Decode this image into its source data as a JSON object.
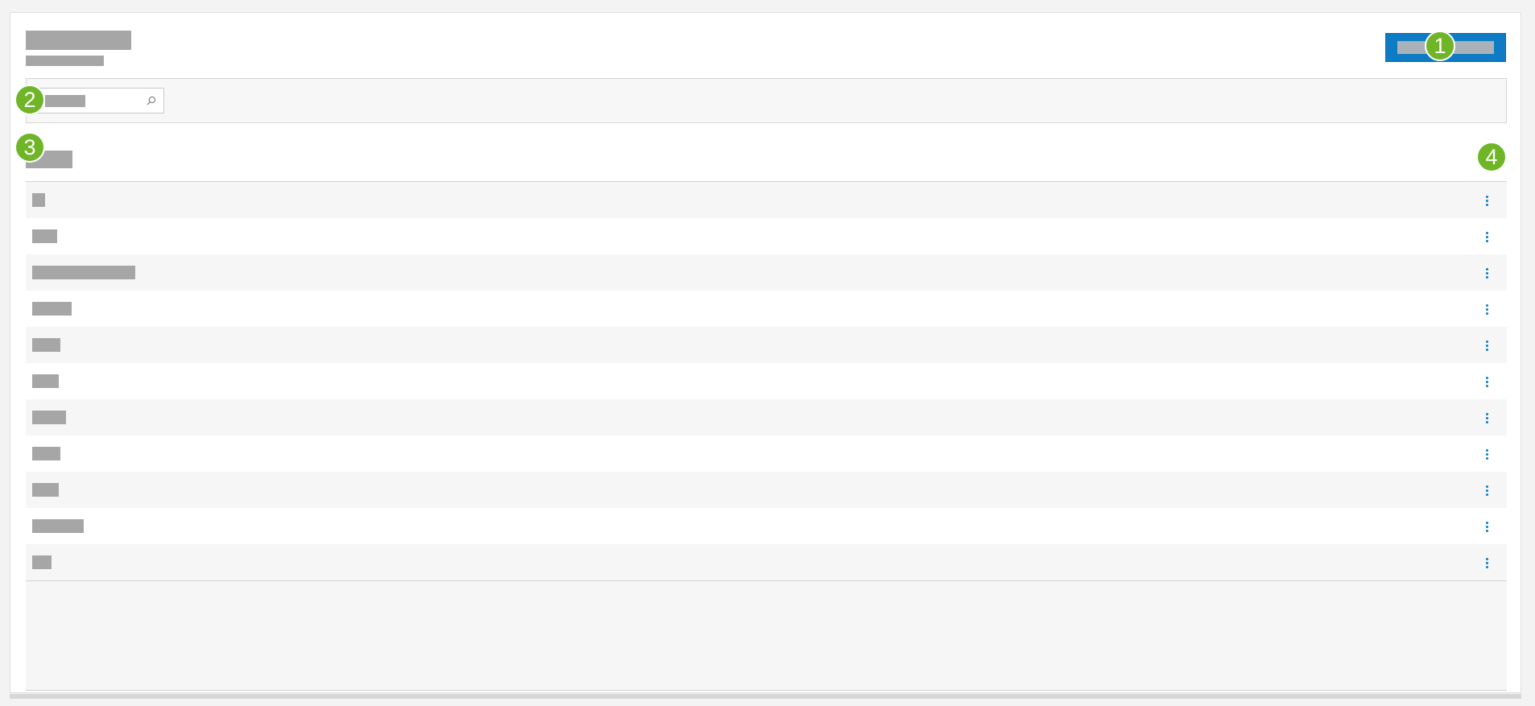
{
  "colors": {
    "accent": "#0e7cc4",
    "callout": "#6fb527",
    "placeholder": "#a6a6a6"
  },
  "header": {
    "title": "",
    "subtitle": "",
    "primary_button_label": ""
  },
  "toolbar": {
    "search": {
      "value": "",
      "placeholder": "",
      "icon": "search-icon"
    }
  },
  "list": {
    "column_header": "",
    "row_action_icon": "kebab-menu-icon",
    "rows": [
      {
        "label": ""
      },
      {
        "label": ""
      },
      {
        "label": ""
      },
      {
        "label": ""
      },
      {
        "label": ""
      },
      {
        "label": ""
      },
      {
        "label": ""
      },
      {
        "label": ""
      },
      {
        "label": ""
      },
      {
        "label": ""
      },
      {
        "label": ""
      }
    ]
  },
  "callouts": [
    "1",
    "2",
    "3",
    "4"
  ]
}
